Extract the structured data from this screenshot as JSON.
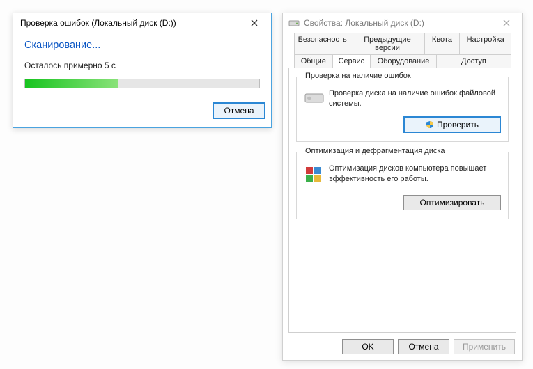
{
  "progress_dialog": {
    "title": "Проверка ошибок (Локальный диск (D:))",
    "heading": "Сканирование...",
    "status": "Осталось примерно 5 с",
    "progress_percent": 40,
    "cancel_label": "Отмена"
  },
  "properties_window": {
    "title": "Свойства: Локальный диск (D:)",
    "tabs_row1": [
      "Безопасность",
      "Предыдущие версии",
      "Квота",
      "Настройка"
    ],
    "tabs_row2": [
      "Общие",
      "Сервис",
      "Оборудование",
      "Доступ"
    ],
    "active_tab": "Сервис",
    "group_check": {
      "legend": "Проверка на наличие ошибок",
      "text": "Проверка диска на наличие ошибок файловой системы.",
      "button": "Проверить"
    },
    "group_optimize": {
      "legend": "Оптимизация и дефрагментация диска",
      "text": "Оптимизация дисков компьютера повышает эффективность его работы.",
      "button": "Оптимизировать"
    },
    "buttons": {
      "ok": "OK",
      "cancel": "Отмена",
      "apply": "Применить"
    }
  }
}
